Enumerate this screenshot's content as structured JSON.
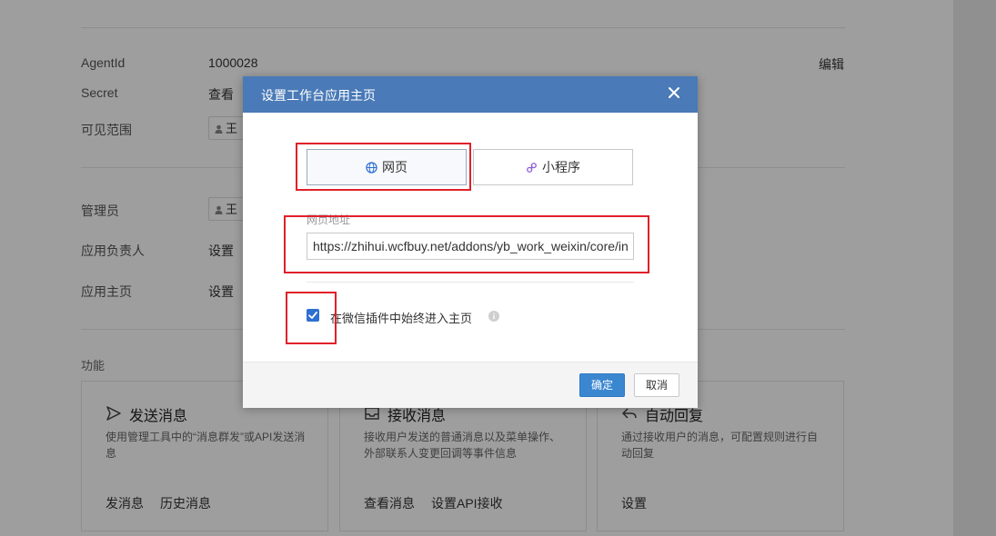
{
  "background": {
    "rows": [
      {
        "label": "AgentId",
        "value": "1000028",
        "action": "编辑"
      },
      {
        "label": "Secret",
        "value": "查看"
      },
      {
        "label": "可见范围",
        "chip": "王"
      },
      {
        "label": "管理员",
        "chip": "王"
      },
      {
        "label": "应用负责人",
        "value": "设置"
      },
      {
        "label": "应用主页",
        "value": "设置"
      }
    ],
    "section_title": "功能",
    "cards": [
      {
        "title": "发送消息",
        "desc": "使用管理工具中的“消息群发”或API发送消息",
        "links": [
          "发消息",
          "历史消息"
        ]
      },
      {
        "title": "接收消息",
        "desc": "接收用户发送的普通消息以及菜单操作、外部联系人变更回调等事件信息",
        "links": [
          "查看消息",
          "设置API接收"
        ]
      },
      {
        "title": "自动回复",
        "desc": "通过接收用户的消息，可配置规则进行自动回复",
        "links": [
          "设置"
        ]
      }
    ]
  },
  "modal": {
    "title": "设置工作台应用主页",
    "tabs": [
      {
        "label": "网页",
        "icon": "globe-icon",
        "active": true
      },
      {
        "label": "小程序",
        "icon": "miniprogram-icon",
        "active": false
      }
    ],
    "url_label": "网页地址",
    "url_value": "https://zhihui.wcfbuy.net/addons/yb_work_weixin/core/index",
    "checkbox_label": "在微信插件中始终进入主页",
    "checkbox_checked": true,
    "confirm_label": "确定",
    "cancel_label": "取消"
  },
  "colors": {
    "header": "#4a7ab7",
    "primary": "#3a87d0",
    "highlight": "#e0202a"
  }
}
